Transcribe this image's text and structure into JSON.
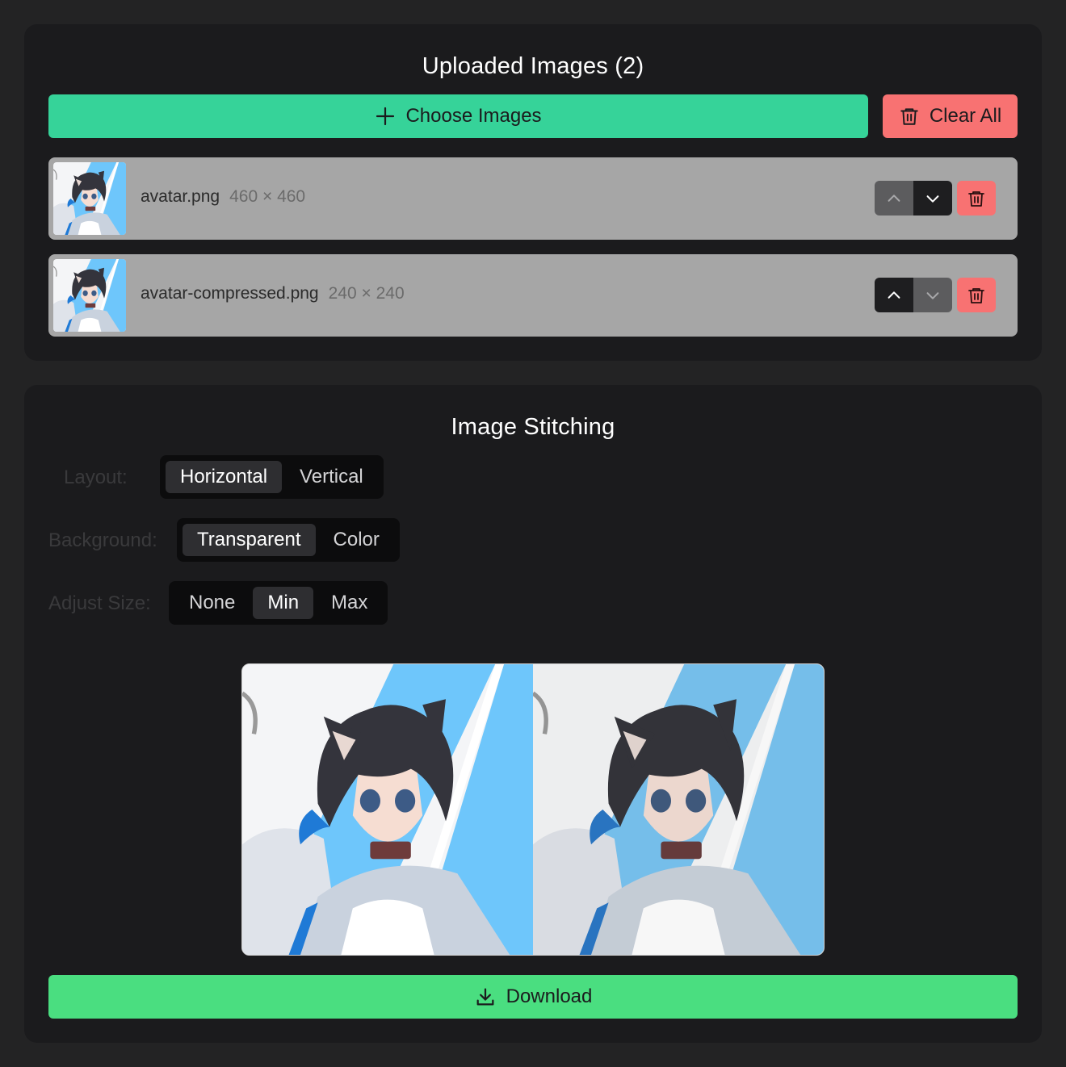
{
  "upload": {
    "title": "Uploaded Images (2)",
    "choose_label": "Choose Images",
    "clear_label": "Clear All",
    "images": [
      {
        "name": "avatar.png",
        "dims": "460 × 460"
      },
      {
        "name": "avatar-compressed.png",
        "dims": "240 × 240"
      }
    ]
  },
  "stitch": {
    "title": "Image Stitching",
    "layout": {
      "label": "Layout:",
      "options": [
        "Horizontal",
        "Vertical"
      ],
      "selected": "Horizontal"
    },
    "background": {
      "label": "Background:",
      "options": [
        "Transparent",
        "Color"
      ],
      "selected": "Transparent"
    },
    "adjust_size": {
      "label": "Adjust Size:",
      "options": [
        "None",
        "Min",
        "Max"
      ],
      "selected": "Min"
    },
    "download_label": "Download"
  },
  "colors": {
    "page_bg": "#232324",
    "panel_bg": "#1b1b1d",
    "primary_green": "#36d399",
    "download_green": "#4ade80",
    "danger_red": "#f87272",
    "row_bg": "#a6a6a6",
    "anime_blue": "#6ec6fb"
  }
}
